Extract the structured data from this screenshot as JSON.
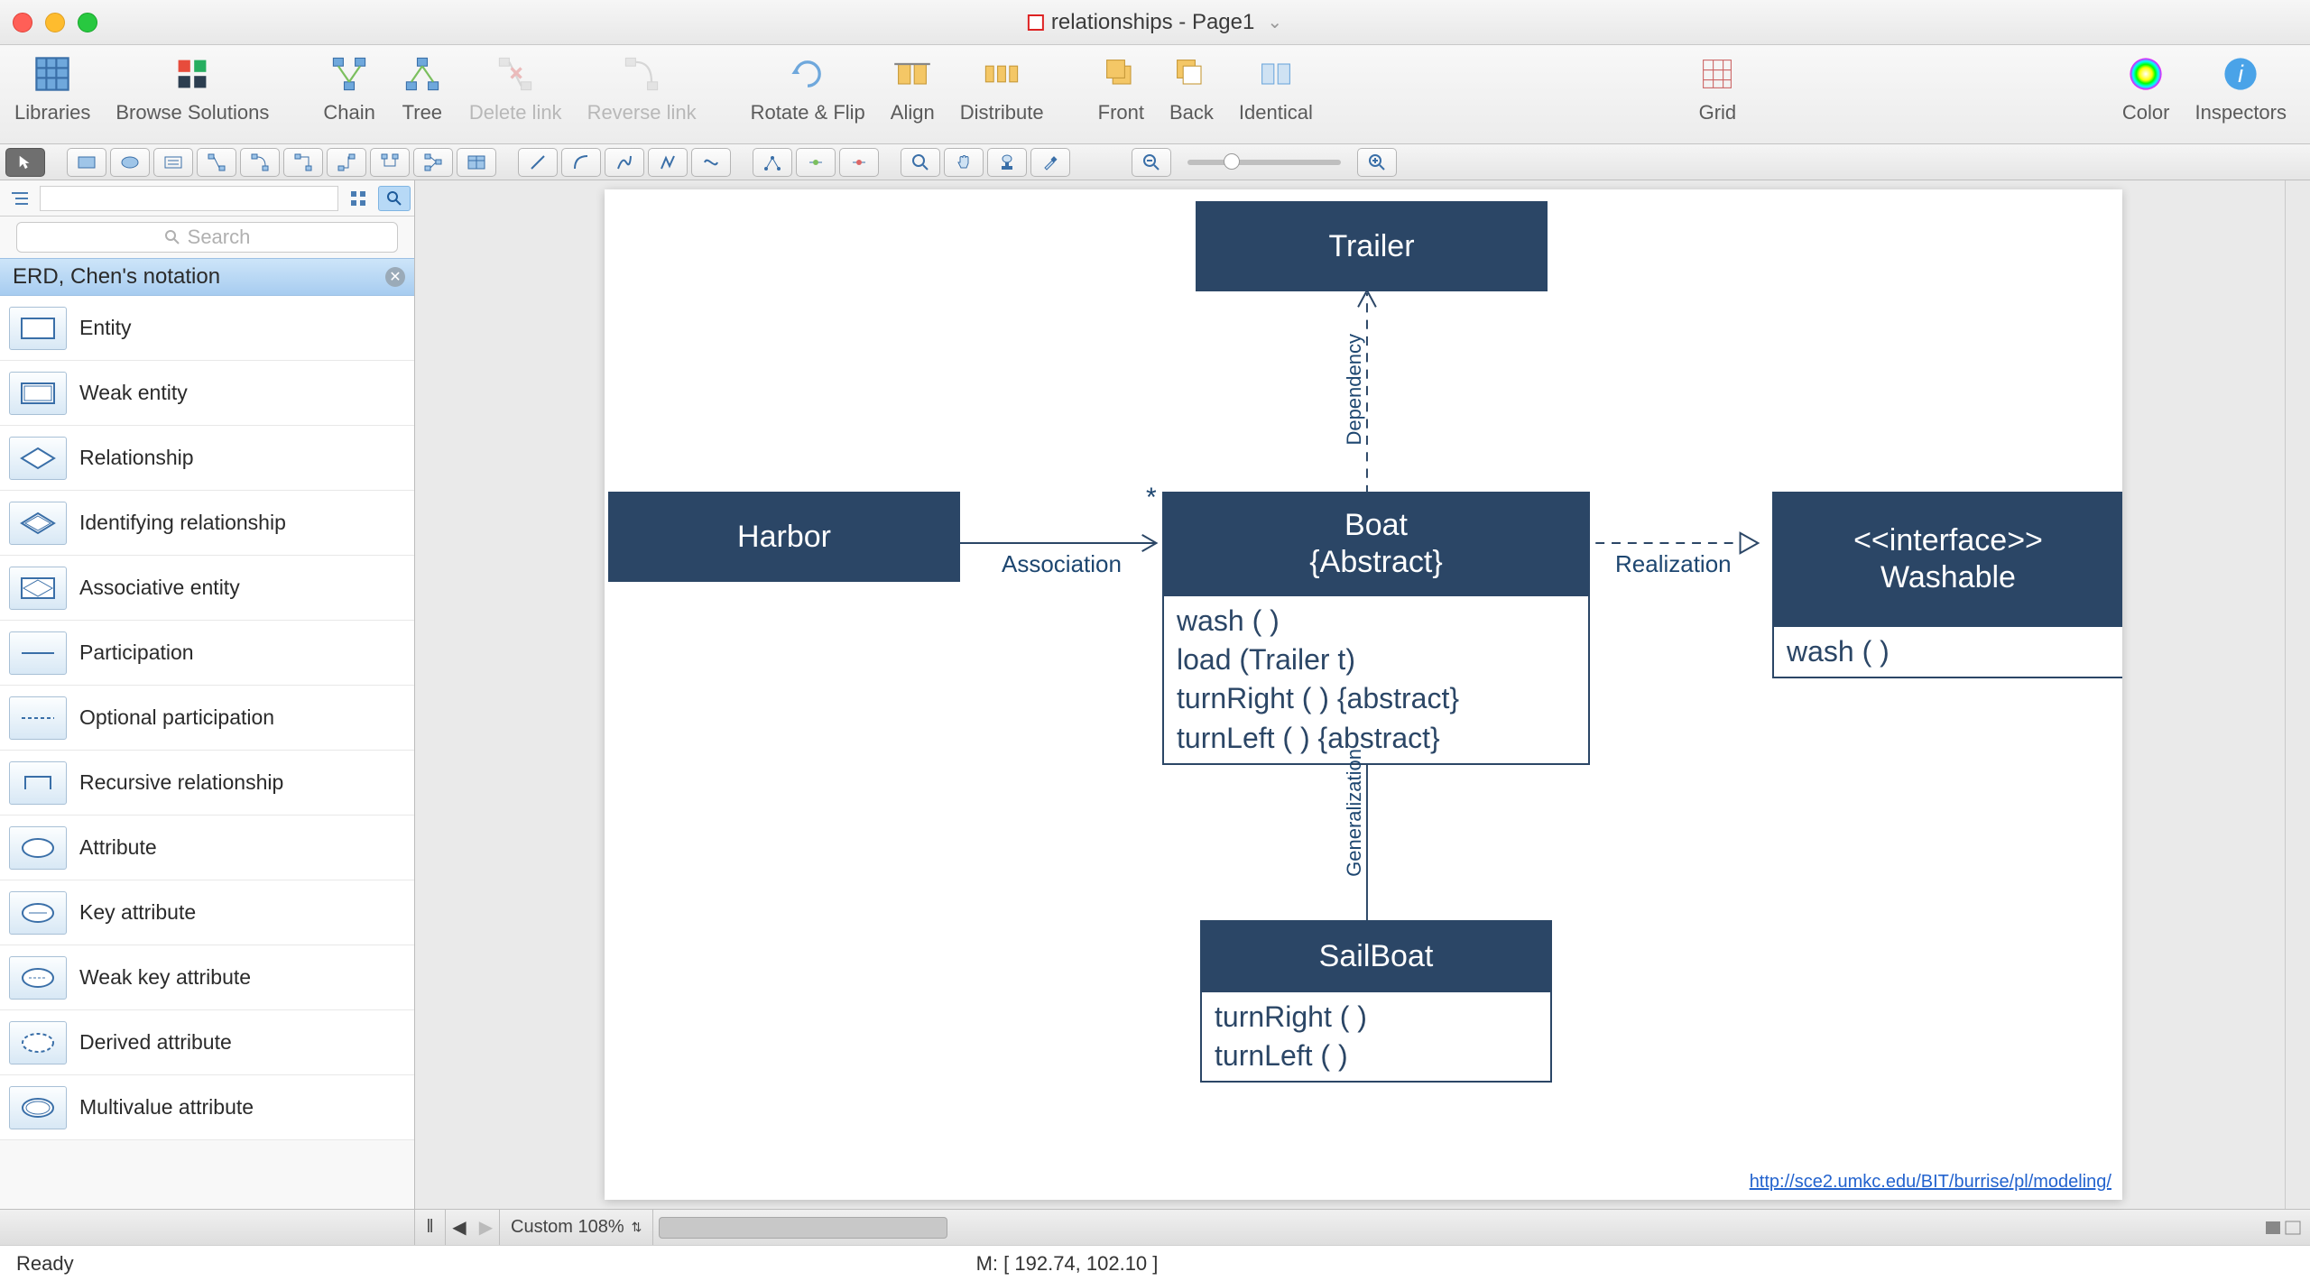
{
  "window": {
    "title": "relationships - Page1"
  },
  "toolbar": {
    "libraries": "Libraries",
    "browse": "Browse Solutions",
    "chain": "Chain",
    "tree": "Tree",
    "delete_link": "Delete link",
    "reverse_link": "Reverse link",
    "rotate_flip": "Rotate & Flip",
    "align": "Align",
    "distribute": "Distribute",
    "front": "Front",
    "back": "Back",
    "identical": "Identical",
    "grid": "Grid",
    "color": "Color",
    "inspectors": "Inspectors"
  },
  "search": {
    "placeholder": "Search"
  },
  "library": {
    "title": "ERD, Chen's notation",
    "items": [
      "Entity",
      "Weak entity",
      "Relationship",
      "Identifying relationship",
      "Associative entity",
      "Participation",
      "Optional participation",
      "Recursive relationship",
      "Attribute",
      "Key attribute",
      "Weak key attribute",
      "Derived attribute",
      "Multivalue attribute"
    ]
  },
  "diagram": {
    "trailer": {
      "title": "Trailer"
    },
    "harbor": {
      "title": "Harbor"
    },
    "boat": {
      "title_line1": "Boat",
      "title_line2": "{Abstract}",
      "m1": "wash ( )",
      "m2": "load (Trailer t)",
      "m3": "turnRight ( ) {abstract}",
      "m4": "turnLeft ( ) {abstract}"
    },
    "washable": {
      "title_line1": "<<interface>>",
      "title_line2": "Washable",
      "m1": "wash ( )"
    },
    "sailboat": {
      "title": "SailBoat",
      "m1": "turnRight ( )",
      "m2": "turnLeft ( )"
    },
    "labels": {
      "dependency": "Dependency",
      "association": "Association",
      "assoc_mult": "*",
      "realization": "Realization",
      "generalization": "Generalization"
    },
    "ref_url": "http://sce2.umkc.edu/BIT/burrise/pl/modeling/"
  },
  "footer": {
    "zoom_label": "Custom 108%",
    "status": "Ready",
    "mouse": "M: [ 192.74, 102.10 ]"
  }
}
